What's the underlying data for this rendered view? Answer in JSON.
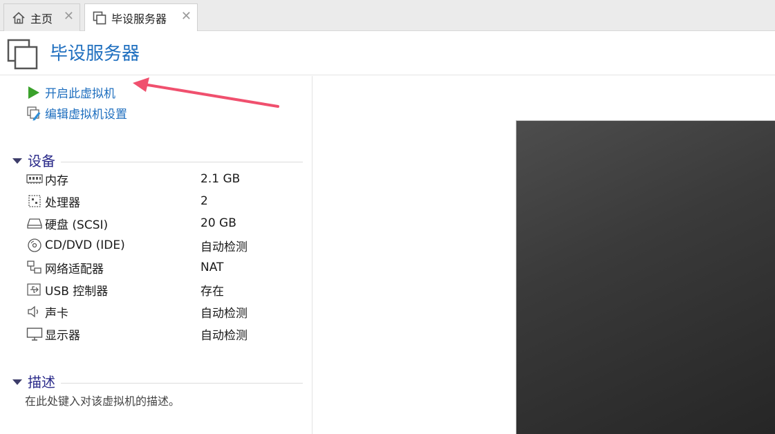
{
  "tabs": [
    {
      "label": "主页",
      "icon": "home-icon"
    },
    {
      "label": "毕设服务器",
      "icon": "vm-icon"
    }
  ],
  "header": {
    "title": "毕设服务器"
  },
  "actions": {
    "power_on": "开启此虚拟机",
    "edit_settings": "编辑虚拟机设置"
  },
  "devices_section": {
    "title": "设备",
    "items": [
      {
        "name": "内存",
        "value": "2.1 GB",
        "icon": "memory-icon"
      },
      {
        "name": "处理器",
        "value": "2",
        "icon": "cpu-icon"
      },
      {
        "name": "硬盘 (SCSI)",
        "value": "20 GB",
        "icon": "hard-disk-icon"
      },
      {
        "name": "CD/DVD (IDE)",
        "value": "自动检测",
        "icon": "cd-dvd-icon"
      },
      {
        "name": "网络适配器",
        "value": "NAT",
        "icon": "network-adapter-icon"
      },
      {
        "name": "USB 控制器",
        "value": "存在",
        "icon": "usb-icon"
      },
      {
        "name": "声卡",
        "value": "自动检测",
        "icon": "sound-card-icon"
      },
      {
        "name": "显示器",
        "value": "自动检测",
        "icon": "display-icon"
      }
    ]
  },
  "description_section": {
    "title": "描述",
    "placeholder": "在此处键入对该虚拟机的描述。"
  },
  "colors": {
    "accent": "#1f6fbf",
    "section": "#2b2b8a",
    "play": "#3aa12b",
    "annotation_arrow": "#f0506e"
  }
}
